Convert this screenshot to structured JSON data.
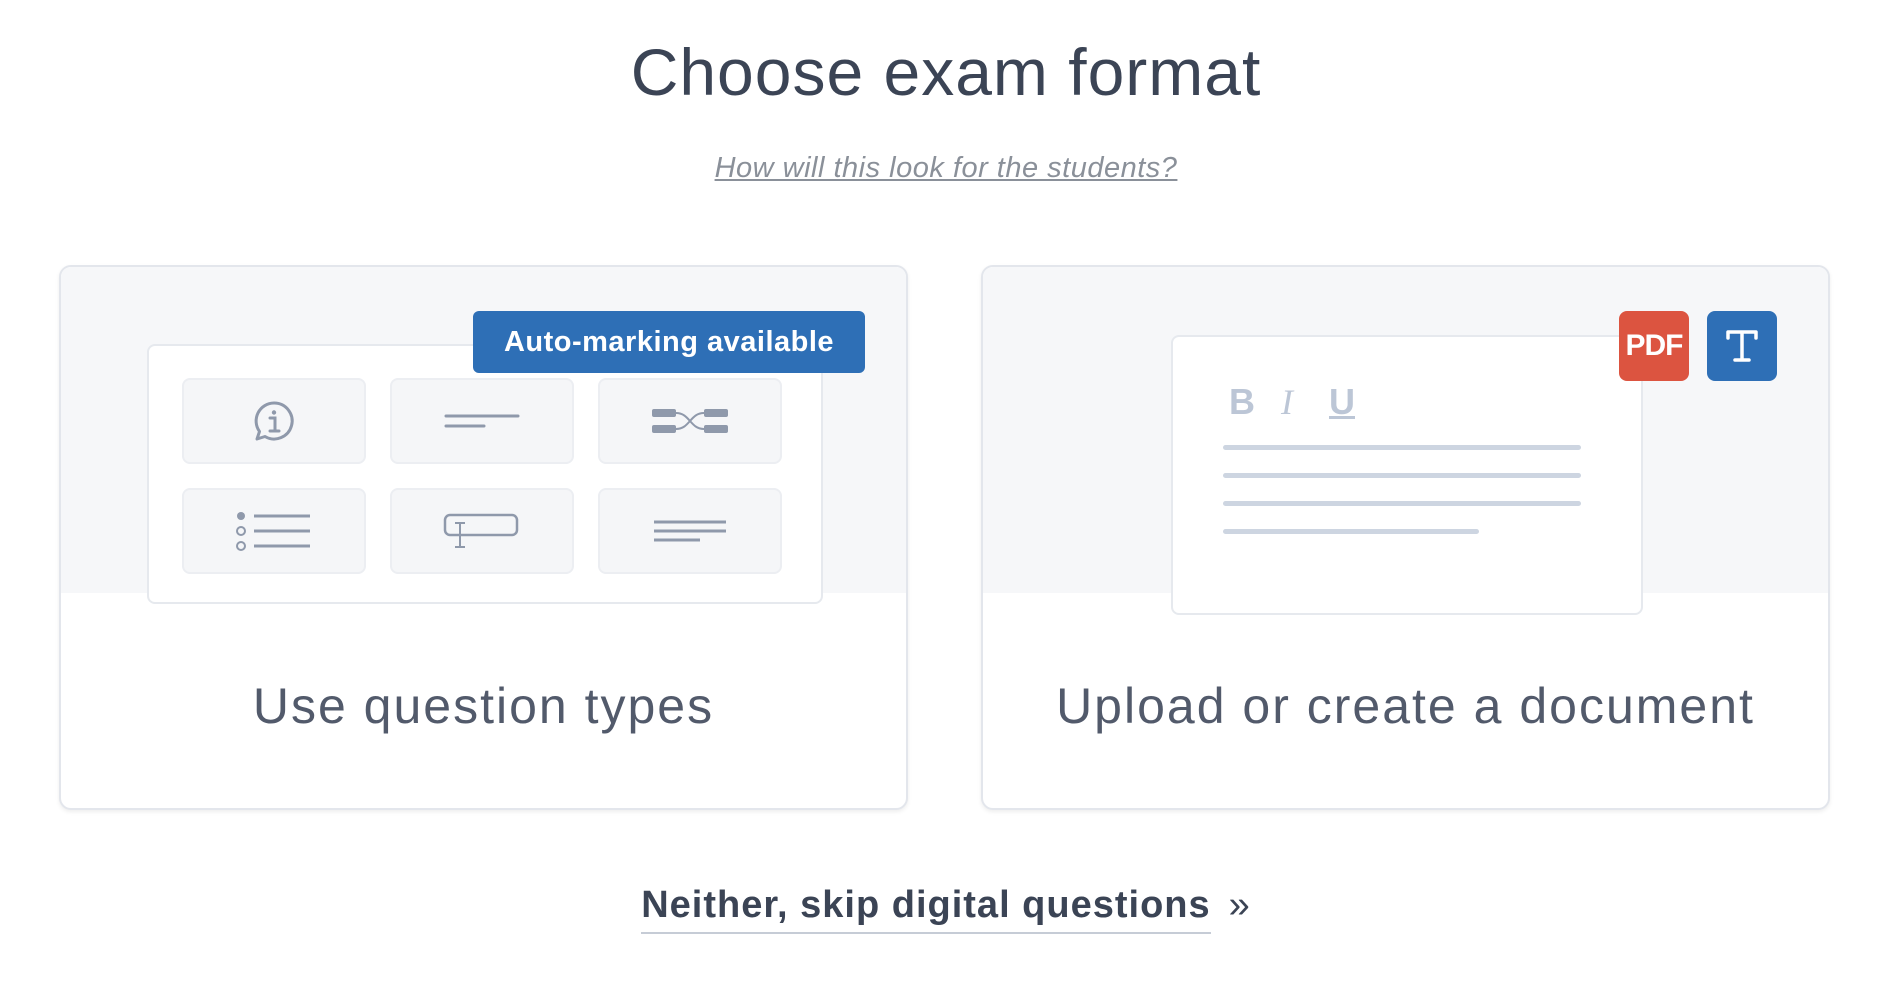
{
  "header": {
    "title": "Choose exam format",
    "help_link": "How will this look for the students?"
  },
  "cards": {
    "question_types": {
      "label": "Use question types",
      "badge": "Auto-marking available",
      "tile_icons": [
        "info-bubble-icon",
        "single-line-icon",
        "matching-icon",
        "multiple-choice-icon",
        "text-input-icon",
        "paragraph-icon"
      ]
    },
    "document": {
      "label": "Upload or create a document",
      "format_buttons": [
        "B",
        "I",
        "U"
      ],
      "pdf_icon_text": "PDF",
      "text_icon_text": "T"
    }
  },
  "footer": {
    "skip_label": "Neither, skip digital questions",
    "skip_arrow": "»"
  },
  "colors": {
    "accent_blue": "#2e6fb6",
    "pdf_red": "#dc5440",
    "title_text": "#3b4455"
  }
}
